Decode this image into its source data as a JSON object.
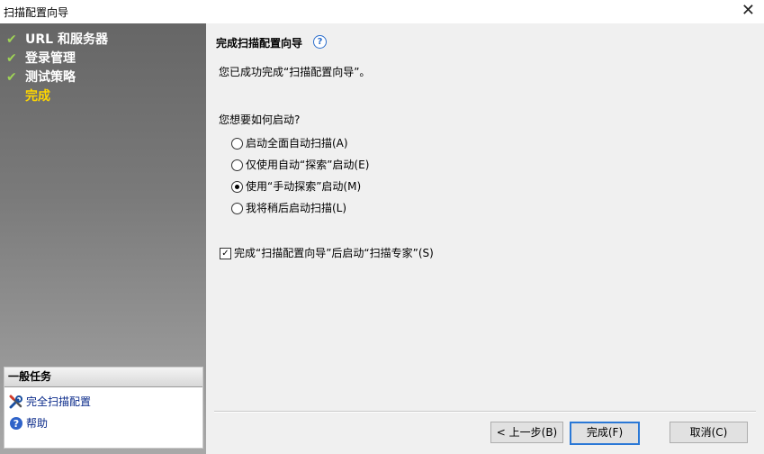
{
  "window": {
    "title": "扫描配置向导",
    "close_glyph": "✕"
  },
  "sidebar": {
    "steps": [
      {
        "label": "URL 和服务器",
        "done": true
      },
      {
        "label": "登录管理",
        "done": true
      },
      {
        "label": "测试策略",
        "done": true
      },
      {
        "label": "完成",
        "done": false,
        "current": true
      }
    ],
    "tasks": {
      "title": "一般任务",
      "items": [
        {
          "label": "完全扫描配置",
          "icon": "tools-icon"
        },
        {
          "label": "帮助",
          "icon": "help-icon"
        }
      ]
    }
  },
  "main": {
    "heading": "完成扫描配置向导",
    "help_glyph": "?",
    "message": "您已成功完成“扫描配置向导”。",
    "question": "您想要如何启动?",
    "options": [
      {
        "label": "启动全面自动扫描(A)",
        "selected": false
      },
      {
        "label": "仅使用自动“探索”启动(E)",
        "selected": false
      },
      {
        "label": "使用“手动探索”启动(M)",
        "selected": true
      },
      {
        "label": "我将稍后启动扫描(L)",
        "selected": false
      }
    ],
    "checkbox": {
      "label": "完成“扫描配置向导”后启动“扫描专家”(S)",
      "checked": true,
      "check_glyph": "✓"
    }
  },
  "buttons": {
    "back": "< 上一步(B)",
    "finish": "完成(F)",
    "cancel": "取消(C)"
  },
  "colors": {
    "current_step": "#ffd700",
    "check": "#9fd356",
    "link": "#0a2a8a",
    "default_button_border": "#2a78d6"
  }
}
